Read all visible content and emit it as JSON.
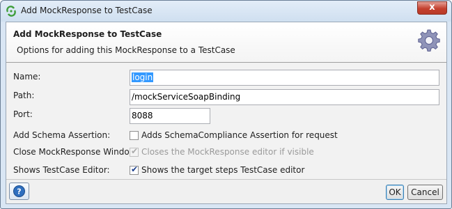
{
  "window": {
    "title": "Add MockResponse to TestCase",
    "close_label": "x"
  },
  "header": {
    "title": "Add MockResponse to TestCase",
    "subtitle": "Options for adding this MockResponse to a TestCase",
    "icon": "gear-icon"
  },
  "form": {
    "name": {
      "label": "Name:",
      "value": "login",
      "selected": true
    },
    "path": {
      "label": "Path:",
      "value": "/mockServiceSoapBinding"
    },
    "port": {
      "label": "Port:",
      "value": "8088"
    },
    "schema_assertion": {
      "label": "Add Schema Assertion:",
      "checkbox_label": "Adds SchemaCompliance Assertion for request",
      "checked": false,
      "enabled": true
    },
    "close_window": {
      "label": "Close MockResponse Window:",
      "checkbox_label": "Closes the MockResponse editor if visible",
      "checked": true,
      "enabled": false
    },
    "show_editor": {
      "label": "Shows TestCase Editor:",
      "checkbox_label": "Shows the target steps TestCase editor",
      "checked": true,
      "enabled": true
    }
  },
  "footer": {
    "help_icon": "help-icon",
    "ok_label": "OK",
    "cancel_label": "Cancel"
  },
  "colors": {
    "title_bar": "#d9e6f4",
    "close_button": "#c4402e",
    "selection": "#3399ff",
    "check_mark": "#1a3e8c"
  }
}
